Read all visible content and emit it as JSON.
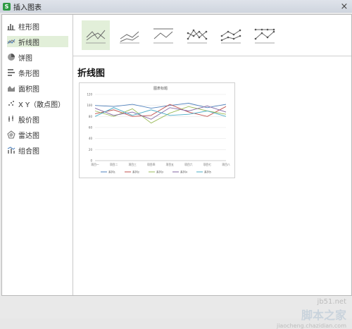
{
  "window": {
    "title": "插入图表",
    "close_glyph": "×"
  },
  "sidebar": {
    "items": [
      {
        "label": "柱形图",
        "icon": "bar-chart-icon"
      },
      {
        "label": "折线图",
        "icon": "line-chart-icon",
        "selected": true
      },
      {
        "label": "饼图",
        "icon": "pie-chart-icon"
      },
      {
        "label": "条形图",
        "icon": "horizontal-bar-chart-icon"
      },
      {
        "label": "面积图",
        "icon": "area-chart-icon"
      },
      {
        "label": "X Y（散点图）",
        "icon": "scatter-chart-icon"
      },
      {
        "label": "股价图",
        "icon": "stock-chart-icon"
      },
      {
        "label": "雷达图",
        "icon": "radar-chart-icon"
      },
      {
        "label": "组合图",
        "icon": "combo-chart-icon"
      }
    ]
  },
  "subtypes": {
    "items": [
      {
        "icon": "line-icon",
        "selected": true
      },
      {
        "icon": "stacked-line-icon"
      },
      {
        "icon": "percent-stacked-line-icon"
      },
      {
        "icon": "line-with-markers-icon"
      },
      {
        "icon": "stacked-line-with-markers-icon"
      },
      {
        "icon": "percent-stacked-line-with-markers-icon"
      }
    ],
    "selected_title": "折线图"
  },
  "colors": {
    "selected_bg": "#e2efd9",
    "series": [
      "#4f81bd",
      "#c0504d",
      "#9bbb59",
      "#8064a2",
      "#4bacc6"
    ]
  },
  "chart_data": {
    "type": "line",
    "title": "图表标题",
    "categories": [
      "项目一",
      "项目二",
      "项目三",
      "项目四",
      "项目五",
      "项目六",
      "项目七",
      "项目八"
    ],
    "ylim": [
      0,
      120
    ],
    "yticks": [
      "0",
      "20",
      "40",
      "60",
      "80",
      "100",
      "120"
    ],
    "grid": true,
    "legend_position": "bottom",
    "series": [
      {
        "name": "系列1",
        "values": [
          100,
          98,
          102,
          95,
          100,
          104,
          96,
          102
        ]
      },
      {
        "name": "系列2",
        "values": [
          85,
          92,
          80,
          82,
          102,
          88,
          80,
          98
        ]
      },
      {
        "name": "系列3",
        "values": [
          90,
          80,
          94,
          68,
          86,
          98,
          90,
          84
        ]
      },
      {
        "name": "系列4",
        "values": [
          95,
          82,
          88,
          75,
          96,
          90,
          99,
          88
        ]
      },
      {
        "name": "系列5",
        "values": [
          80,
          96,
          82,
          92,
          82,
          84,
          90,
          80
        ]
      }
    ]
  },
  "watermark": {
    "site": "jb51.net",
    "big": "脚本之家",
    "sub": "jiaocheng.chazidian.com"
  }
}
